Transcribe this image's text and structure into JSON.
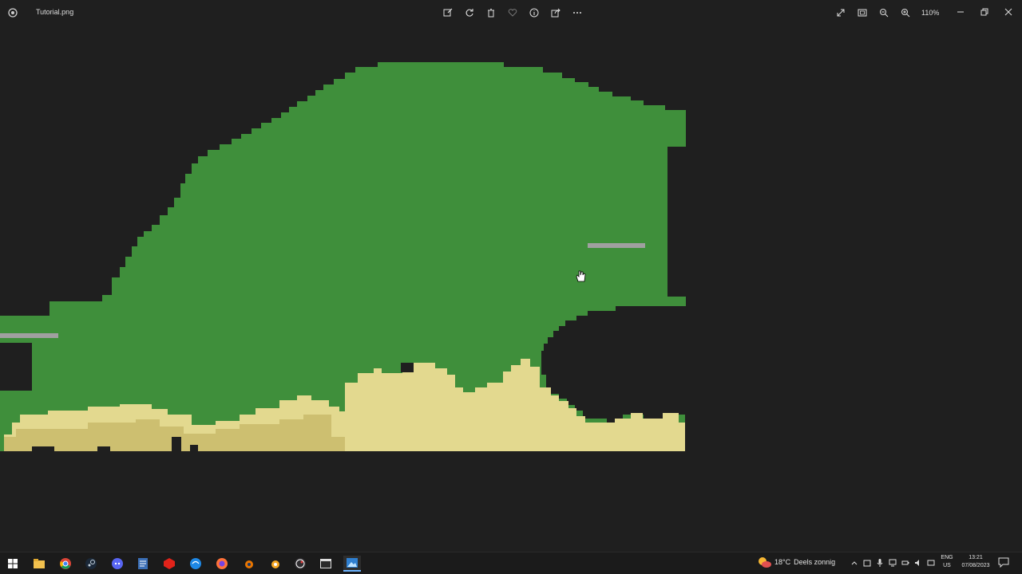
{
  "window": {
    "title": "Tutorial.png",
    "zoom_label": "110%"
  },
  "toolbar": {
    "buttons": [
      "edit-icon",
      "rotate-icon",
      "delete-icon",
      "favorite-icon",
      "info-icon",
      "share-icon",
      "more-icon"
    ]
  },
  "right_tools": [
    "fullscreen-icon",
    "fit-window-icon",
    "zoom-out-icon",
    "zoom-in-icon"
  ],
  "image": {
    "colors": {
      "background": "#1f1f1f",
      "grass": "#3f8f3b",
      "sand": "#e3d98f",
      "sand_dark": "#cdbf70",
      "rail": "#a0a0a0"
    }
  },
  "taskbar": {
    "apps": [
      "start-icon",
      "file-explorer-icon",
      "chrome-icon",
      "steam-icon",
      "discord-icon",
      "notepad-icon",
      "roblox-studio-icon",
      "browser-icon",
      "firefox-icon",
      "blender-icon",
      "blender-alt-icon",
      "obs-icon",
      "generic-window-icon",
      "photos-icon"
    ],
    "weather": {
      "temp": "18°C",
      "desc": "Deels zonnig"
    },
    "language": {
      "line1": "ENG",
      "line2": "US"
    },
    "clock": {
      "time": "13:21",
      "date": "07/08/2023"
    }
  }
}
